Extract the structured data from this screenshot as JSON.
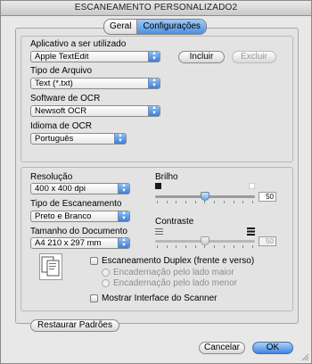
{
  "window": {
    "title": "ESCANEAMENTO PERSONALIZADO2"
  },
  "tabs": [
    {
      "label": "Geral"
    },
    {
      "label": "Configurações"
    }
  ],
  "app_section": {
    "label": "Aplicativo a ser utilizado",
    "value": "Apple TextEdit",
    "add_label": "Incluir",
    "delete_label": "Excluir"
  },
  "file_type": {
    "label": "Tipo de Arquivo",
    "value": "Text (*.txt)"
  },
  "ocr_software": {
    "label": "Software de OCR",
    "value": "Newsoft OCR"
  },
  "ocr_language": {
    "label": "Idioma de OCR",
    "value": "Português"
  },
  "scan_settings": {
    "resolution": {
      "label": "Resolução",
      "value": "400 x 400 dpi"
    },
    "scan_type": {
      "label": "Tipo de Escaneamento",
      "value": "Preto e Branco"
    },
    "doc_size": {
      "label": "Tamanho do Documento",
      "value": "A4  210 x 297 mm"
    },
    "brightness": {
      "label": "Brilho",
      "value": "50",
      "level": 0.5
    },
    "contrast": {
      "label": "Contraste",
      "value": "50",
      "level": 0.5
    },
    "duplex": {
      "label": "Escaneamento Duplex (frente e verso)",
      "long_edge": "Encadernação pelo lado maior",
      "short_edge": "Encadernação pelo lado menor"
    },
    "show_interface": {
      "label": "Mostrar Interface do Scanner"
    }
  },
  "footer": {
    "restore_label": "Restaurar Padrões",
    "cancel_label": "Cancelar",
    "ok_label": "OK"
  }
}
